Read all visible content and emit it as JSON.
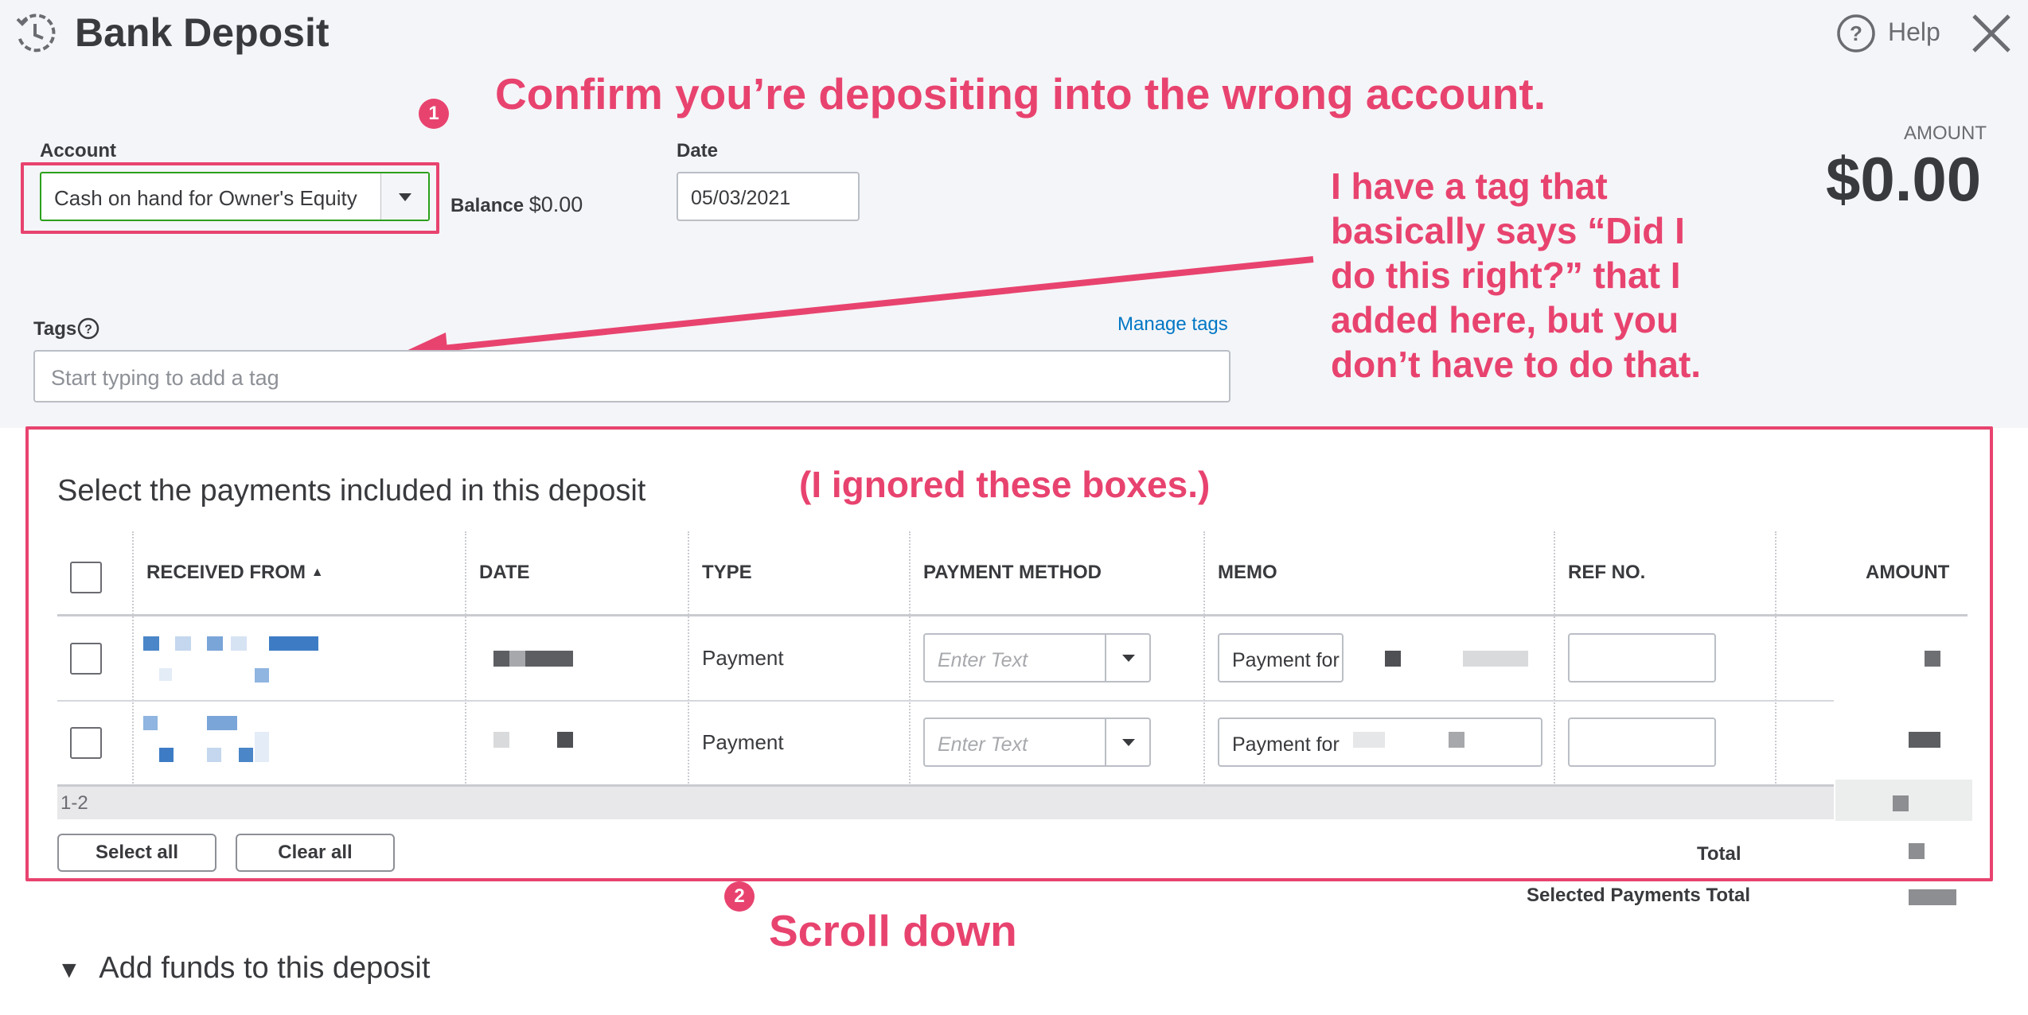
{
  "header": {
    "title": "Bank Deposit",
    "help_label": "Help",
    "history_icon": "history-clock-icon",
    "help_icon": "question-circle-icon",
    "close_icon": "close-x-icon"
  },
  "form": {
    "account_label": "Account",
    "account_value": "Cash on hand for Owner's Equity",
    "balance_label": "Balance",
    "balance_value": "$0.00",
    "date_label": "Date",
    "date_value": "05/03/2021",
    "amount_label": "AMOUNT",
    "amount_value": "$0.00",
    "tags_label": "Tags",
    "manage_tags": "Manage tags",
    "tags_placeholder": "Start typing to add a tag"
  },
  "payments": {
    "heading": "Select the payments included in this deposit",
    "columns": [
      "RECEIVED FROM",
      "DATE",
      "TYPE",
      "PAYMENT METHOD",
      "MEMO",
      "REF NO.",
      "AMOUNT"
    ],
    "sort_indicator": "▲",
    "rows": [
      {
        "type": "Payment",
        "method_placeholder": "Enter Text",
        "memo": "Payment for"
      },
      {
        "type": "Payment",
        "method_placeholder": "Enter Text",
        "memo": "Payment for"
      }
    ],
    "range": "1-2",
    "select_all": "Select all",
    "clear_all": "Clear all",
    "total_label": "Total",
    "selected_total_label": "Selected Payments Total"
  },
  "add_funds": {
    "toggle": "▼",
    "label": "Add funds to this deposit"
  },
  "annotations": {
    "step1_badge": "1",
    "step1_text": "Confirm you’re depositing into the wrong account.",
    "tag_note": [
      "I have a tag that",
      "basically says “Did I",
      "do this right?” that I",
      "added here, but you",
      "don’t have to do that."
    ],
    "ignored_note": "(I ignored these boxes.)",
    "step2_badge": "2",
    "step2_text": "Scroll down"
  },
  "colors": {
    "annotation": "#e8436f",
    "accent_green": "#2ca01c",
    "link_blue": "#0077c5",
    "panel_bg": "#f4f5f8"
  }
}
